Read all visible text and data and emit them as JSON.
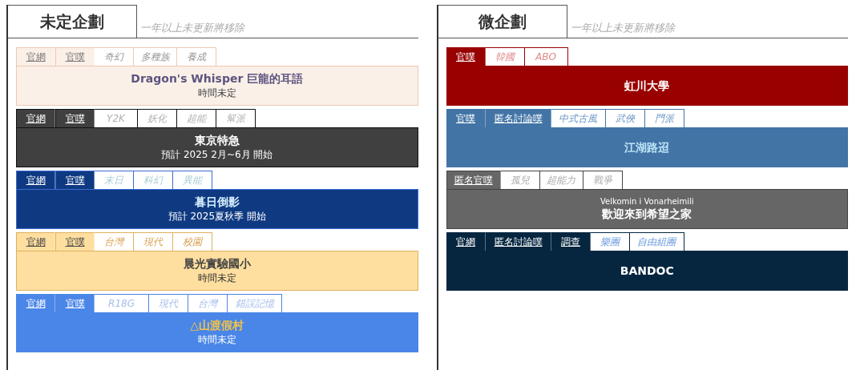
{
  "sections": [
    {
      "title": "未定企劃",
      "note": "一年以上未更新將移除",
      "cards": [
        {
          "kind": "pastel",
          "color": "#fbf0e8",
          "links": [
            "官網",
            "官噗"
          ],
          "tags": [
            "奇幻",
            "多種族",
            "養成"
          ],
          "title": "Dragon's Whisper 巨龍的耳語",
          "subtitle": "時間未定"
        },
        {
          "kind": "charcoal",
          "color": "#404040",
          "links": [
            "官網",
            "官噗"
          ],
          "tags": [
            "Y2K",
            "妖化",
            "超能",
            "幫派"
          ],
          "title": "東京特急",
          "subtitle": "預計 2025 2月~6月 開始"
        },
        {
          "kind": "navy",
          "color": "#0f3a82",
          "links": [
            "官網",
            "官噗"
          ],
          "tags": [
            "末日",
            "科幻",
            "異能"
          ],
          "title": "暮日倒影",
          "subtitle": "預計 2025夏秋季 開始"
        },
        {
          "kind": "amber",
          "color": "#ffdf9f",
          "links": [
            "官網",
            "官噗"
          ],
          "tags": [
            "台灣",
            "現代",
            "校園"
          ],
          "title": "晨光實驗國小",
          "subtitle": "時間未定"
        },
        {
          "kind": "sky",
          "color": "#4a86e8",
          "links": [
            "官網",
            "官噗"
          ],
          "tags": [
            "R18G",
            "現代",
            "台灣",
            "錯誤記憶"
          ],
          "title": "△山渡假村",
          "subtitle": "時間未定"
        }
      ]
    },
    {
      "title": "微企劃",
      "note": "一年以上未更新將移除",
      "cards": [
        {
          "kind": "crimson",
          "color": "#990000",
          "links": [
            "官噗"
          ],
          "tags": [
            "韓國",
            "ABO"
          ],
          "title": "虹川大學"
        },
        {
          "kind": "steel",
          "color": "#4274a6",
          "links": [
            "官噗",
            "匿名討論噗"
          ],
          "tags": [
            "中式古風",
            "武俠",
            "門派"
          ],
          "title": "江湖路迢"
        },
        {
          "kind": "gray",
          "color": "#666666",
          "links": [
            "匿名官噗"
          ],
          "tags": [
            "孤兒",
            "超能力",
            "戰爭"
          ],
          "kicker": "Velkomin i Vonarheimili",
          "title": "歡迎來到希望之家"
        },
        {
          "kind": "midnight",
          "color": "#062640",
          "links": [
            "官網",
            "匿名討論噗",
            "調查"
          ],
          "tags": [
            "樂團",
            "自由組團"
          ],
          "title": "BANDOC"
        }
      ]
    }
  ]
}
